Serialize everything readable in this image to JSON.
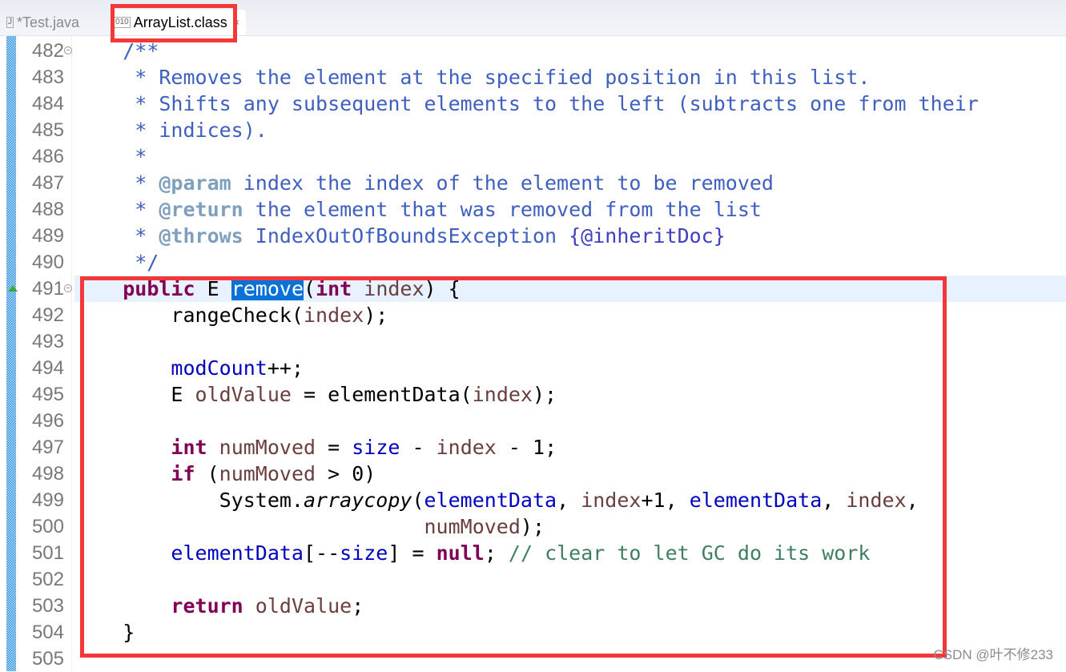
{
  "tabs": [
    {
      "label": "*Test.java",
      "icon": "java-file-icon",
      "active": false
    },
    {
      "label": "ArrayList.class",
      "icon": "class-file-icon",
      "active": true,
      "close": "×"
    }
  ],
  "colors": {
    "annotation_box": "#f4383a",
    "selection": "#0a72d6",
    "current_line": "#e8f2fe"
  },
  "code": {
    "current_line": 491,
    "lines": [
      {
        "n": "482",
        "fold": true,
        "tokens": [
          {
            "s": "p",
            "t": "    "
          },
          {
            "s": "c",
            "t": "/**"
          }
        ]
      },
      {
        "n": "483",
        "tokens": [
          {
            "s": "c",
            "t": "     * Removes the element at the specified position in this list."
          }
        ]
      },
      {
        "n": "484",
        "tokens": [
          {
            "s": "c",
            "t": "     * Shifts any subsequent elements to the left (subtracts one from their"
          }
        ]
      },
      {
        "n": "485",
        "tokens": [
          {
            "s": "c",
            "t": "     * indices)."
          }
        ]
      },
      {
        "n": "486",
        "tokens": [
          {
            "s": "c",
            "t": "     *"
          }
        ]
      },
      {
        "n": "487",
        "tokens": [
          {
            "s": "c",
            "t": "     * "
          },
          {
            "s": "t",
            "t": "@param"
          },
          {
            "s": "c",
            "t": " index the index of the element to be removed"
          }
        ]
      },
      {
        "n": "488",
        "tokens": [
          {
            "s": "c",
            "t": "     * "
          },
          {
            "s": "t",
            "t": "@return"
          },
          {
            "s": "c",
            "t": " the element that was removed from the list"
          }
        ]
      },
      {
        "n": "489",
        "tokens": [
          {
            "s": "c",
            "t": "     * "
          },
          {
            "s": "t",
            "t": "@throws"
          },
          {
            "s": "c",
            "t": " IndexOutOfBoundsException "
          },
          {
            "s": "id",
            "t": "{@inheritDoc}"
          }
        ]
      },
      {
        "n": "490",
        "tokens": [
          {
            "s": "c",
            "t": "     */"
          }
        ]
      },
      {
        "n": "491",
        "fold": true,
        "override": true,
        "tokens": [
          {
            "s": "p",
            "t": "    "
          },
          {
            "s": "k",
            "t": "public"
          },
          {
            "s": "p",
            "t": " E "
          },
          {
            "s": "sel",
            "t": "remove"
          },
          {
            "s": "p",
            "t": "("
          },
          {
            "s": "k",
            "t": "int"
          },
          {
            "s": "p",
            "t": " "
          },
          {
            "s": "v",
            "t": "index"
          },
          {
            "s": "p",
            "t": ") {"
          }
        ]
      },
      {
        "n": "492",
        "tokens": [
          {
            "s": "p",
            "t": "        rangeCheck("
          },
          {
            "s": "v",
            "t": "index"
          },
          {
            "s": "p",
            "t": ");"
          }
        ]
      },
      {
        "n": "493",
        "tokens": []
      },
      {
        "n": "494",
        "tokens": [
          {
            "s": "p",
            "t": "        "
          },
          {
            "s": "f",
            "t": "modCount"
          },
          {
            "s": "p",
            "t": "++;"
          }
        ]
      },
      {
        "n": "495",
        "tokens": [
          {
            "s": "p",
            "t": "        E "
          },
          {
            "s": "v",
            "t": "oldValue"
          },
          {
            "s": "p",
            "t": " = elementData("
          },
          {
            "s": "v",
            "t": "index"
          },
          {
            "s": "p",
            "t": ");"
          }
        ]
      },
      {
        "n": "496",
        "tokens": []
      },
      {
        "n": "497",
        "tokens": [
          {
            "s": "p",
            "t": "        "
          },
          {
            "s": "k",
            "t": "int"
          },
          {
            "s": "p",
            "t": " "
          },
          {
            "s": "v",
            "t": "numMoved"
          },
          {
            "s": "p",
            "t": " = "
          },
          {
            "s": "f",
            "t": "size"
          },
          {
            "s": "p",
            "t": " - "
          },
          {
            "s": "v",
            "t": "index"
          },
          {
            "s": "p",
            "t": " - 1;"
          }
        ]
      },
      {
        "n": "498",
        "tokens": [
          {
            "s": "p",
            "t": "        "
          },
          {
            "s": "k",
            "t": "if"
          },
          {
            "s": "p",
            "t": " ("
          },
          {
            "s": "v",
            "t": "numMoved"
          },
          {
            "s": "p",
            "t": " > 0)"
          }
        ]
      },
      {
        "n": "499",
        "tokens": [
          {
            "s": "p",
            "t": "            System."
          },
          {
            "s": "m",
            "t": "arraycopy"
          },
          {
            "s": "p",
            "t": "("
          },
          {
            "s": "f",
            "t": "elementData"
          },
          {
            "s": "p",
            "t": ", "
          },
          {
            "s": "v",
            "t": "index"
          },
          {
            "s": "p",
            "t": "+1, "
          },
          {
            "s": "f",
            "t": "elementData"
          },
          {
            "s": "p",
            "t": ", "
          },
          {
            "s": "v",
            "t": "index"
          },
          {
            "s": "p",
            "t": ","
          }
        ]
      },
      {
        "n": "500",
        "tokens": [
          {
            "s": "p",
            "t": "                             "
          },
          {
            "s": "v",
            "t": "numMoved"
          },
          {
            "s": "p",
            "t": ");"
          }
        ]
      },
      {
        "n": "501",
        "tokens": [
          {
            "s": "p",
            "t": "        "
          },
          {
            "s": "f",
            "t": "elementData"
          },
          {
            "s": "p",
            "t": "[--"
          },
          {
            "s": "f",
            "t": "size"
          },
          {
            "s": "p",
            "t": "] = "
          },
          {
            "s": "k",
            "t": "null"
          },
          {
            "s": "p",
            "t": "; "
          },
          {
            "s": "lc",
            "t": "// clear to let GC do its work"
          }
        ]
      },
      {
        "n": "502",
        "tokens": []
      },
      {
        "n": "503",
        "tokens": [
          {
            "s": "p",
            "t": "        "
          },
          {
            "s": "k",
            "t": "return"
          },
          {
            "s": "p",
            "t": " "
          },
          {
            "s": "v",
            "t": "oldValue"
          },
          {
            "s": "p",
            "t": ";"
          }
        ]
      },
      {
        "n": "504",
        "tokens": [
          {
            "s": "p",
            "t": "    }"
          }
        ]
      },
      {
        "n": "505",
        "tokens": []
      }
    ]
  },
  "watermark": "CSDN @叶不修233"
}
